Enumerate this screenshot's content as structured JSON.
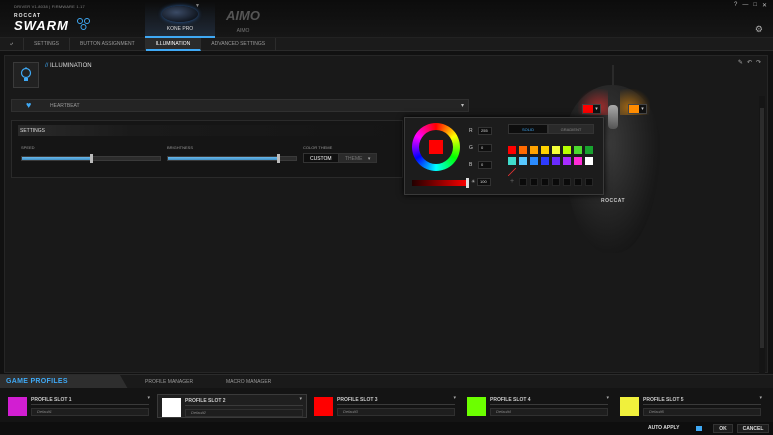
{
  "header": {
    "driver_info": "DRIVER V1.8038 | FIRMWARE 1.17",
    "brand_top": "ROCCAT",
    "brand_main": "SWARM",
    "devices": [
      {
        "label": "KONE PRO",
        "active": true
      },
      {
        "label": "AIMO",
        "word": "AIMO",
        "active": false
      }
    ],
    "window_controls": [
      "?",
      "—",
      "□",
      "✕"
    ]
  },
  "tabs": [
    "SETTINGS",
    "BUTTON ASSIGNMENT",
    "ILLUMINATION",
    "ADVANCED SETTINGS"
  ],
  "active_tab": "ILLUMINATION",
  "illumination": {
    "title_prefix": "//",
    "title": "ILLUMINATION",
    "effect": "HEARTBEAT",
    "settings_title": "SETTINGS",
    "speed_label": "SPEED",
    "speed_value": 0.5,
    "brightness_label": "BRIGHTNESS",
    "brightness_value": 0.86,
    "color_theme_label": "COLOR THEME",
    "color_theme_custom": "CUSTOM",
    "color_theme_theme": "THEME"
  },
  "color_picker": {
    "selected_color": "#ff0000",
    "r_label": "R",
    "r_value": "255",
    "g_label": "G",
    "g_value": "0",
    "b_label": "B",
    "b_value": "0",
    "brightness_value": "100",
    "mode_solid": "SOLID",
    "mode_gradient": "GRADIENT",
    "palette": [
      "#ff0000",
      "#ff6a00",
      "#ffa200",
      "#ffd200",
      "#f5ff3a",
      "#b6ff00",
      "#4cd92f",
      "#18a32f",
      "#40dccc",
      "#58c8ff",
      "#2b8cff",
      "#2e3cff",
      "#6a2bff",
      "#a82bff",
      "#ff2bd6",
      "#ffffff"
    ]
  },
  "mouse": {
    "brand": "ROCCAT",
    "zone_left_color": "#ff0000",
    "zone_right_color": "#ff8c00"
  },
  "bottom": {
    "game_profiles": "GAME PROFILES",
    "profile_manager": "PROFILE MANAGER",
    "macro_manager": "MACRO MANAGER",
    "slots": [
      {
        "name": "PROFILE SLOT 1",
        "profile": "Default1",
        "color": "#d21ed2"
      },
      {
        "name": "PROFILE SLOT 2",
        "profile": "Default2",
        "color": "#ffffff"
      },
      {
        "name": "PROFILE SLOT 3",
        "profile": "Default3",
        "color": "#ff0000"
      },
      {
        "name": "PROFILE SLOT 4",
        "profile": "Default4",
        "color": "#6cff00"
      },
      {
        "name": "PROFILE SLOT 5",
        "profile": "Default5",
        "color": "#f0f03c"
      }
    ],
    "auto_apply": "AUTO APPLY",
    "ok": "OK",
    "cancel": "CANCEL"
  }
}
